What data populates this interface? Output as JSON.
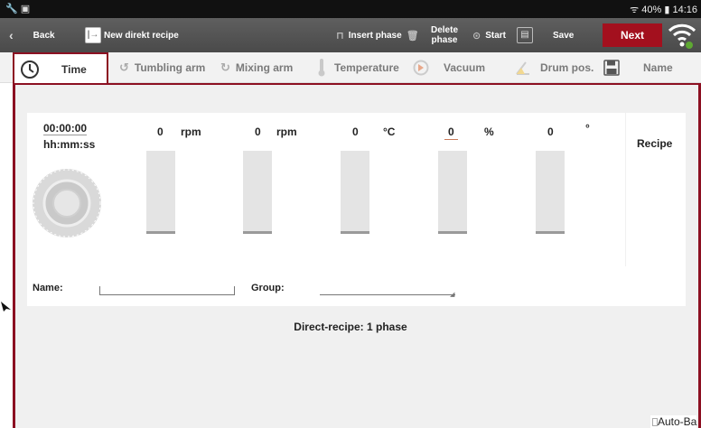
{
  "status_bar": {
    "left_icons": "🔧 ▣",
    "battery": "40%",
    "time": "14:16"
  },
  "toolbar": {
    "back_label": "Back",
    "title": "New direkt recipe",
    "insert_phase_label": "Insert phase",
    "delete_phase_label_1": "Delete",
    "delete_phase_label_2": "phase",
    "start_label": "Start",
    "save_label": "Save",
    "next_label": "Next"
  },
  "tabs": {
    "time": "Time",
    "tumbling_arm": "Tumbling arm",
    "mixing_arm": "Mixing arm",
    "temperature": "Temperature",
    "vacuum": "Vacuum",
    "drum_pos": "Drum pos.",
    "name": "Name"
  },
  "gauges": {
    "time_value": "00:00:00",
    "time_format": "hh:mm:ss",
    "tumbling": {
      "value": "0",
      "unit": "rpm"
    },
    "mixing": {
      "value": "0",
      "unit": "rpm"
    },
    "temperature": {
      "value": "0",
      "unit": "°C"
    },
    "vacuum": {
      "value": "0",
      "unit": "%"
    },
    "drum": {
      "value": "0",
      "unit": "°"
    }
  },
  "recipe_label": "Recipe",
  "form": {
    "name_label": "Name:",
    "group_label": "Group:",
    "name_value": "",
    "group_value": ""
  },
  "phase_info": "Direct-recipe: 1 phase",
  "auto_bar_label": "Auto-Ba",
  "colors": {
    "accent": "#8c1022",
    "toolbar": "#555555",
    "next": "#a3101e"
  }
}
